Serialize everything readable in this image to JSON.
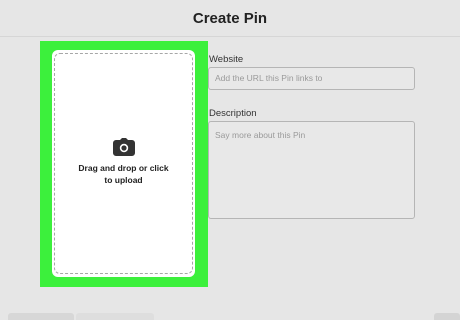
{
  "header": {
    "title": "Create Pin"
  },
  "upload": {
    "text": "Drag and drop or click to upload",
    "icon": "camera-icon"
  },
  "form": {
    "website": {
      "label": "Website",
      "placeholder": "Add the URL this Pin links to"
    },
    "description": {
      "label": "Description",
      "placeholder": "Say more about this Pin"
    }
  },
  "colors": {
    "highlight": "#3cf03c",
    "background": "#e6e6e6"
  }
}
